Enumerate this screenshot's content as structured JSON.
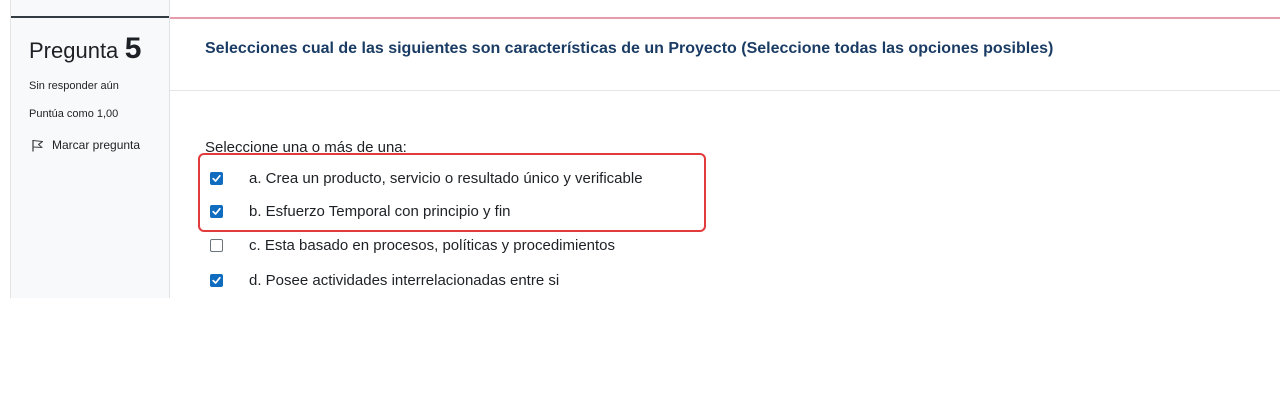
{
  "info": {
    "question_word": "Pregunta",
    "question_number": "5",
    "state": "Sin responder aún",
    "grade": "Puntúa como 1,00",
    "flag_label": "Marcar pregunta"
  },
  "question": {
    "text": "Selecciones cual de las siguientes son características de un Proyecto (Seleccione todas las opciones posibles)",
    "prompt": "Seleccione una o más de una:",
    "answers": [
      {
        "label": "a. Crea un producto, servicio o resultado único y verificable",
        "checked": true
      },
      {
        "label": "b. Esfuerzo Temporal con principio y fin",
        "checked": true
      },
      {
        "label": "c. Esta basado en procesos, políticas y procedimientos",
        "checked": false
      },
      {
        "label": "d. Posee actividades interrelacionadas entre si",
        "checked": true
      }
    ]
  },
  "colors": {
    "checkbox_checked": "#0f6cbf",
    "question_text": "#1a3c64",
    "highlight_border": "#e23b3b",
    "accent_line": "#e89cab"
  },
  "icons": {
    "flag": "flag-icon",
    "checkmark": "checkmark-icon"
  }
}
